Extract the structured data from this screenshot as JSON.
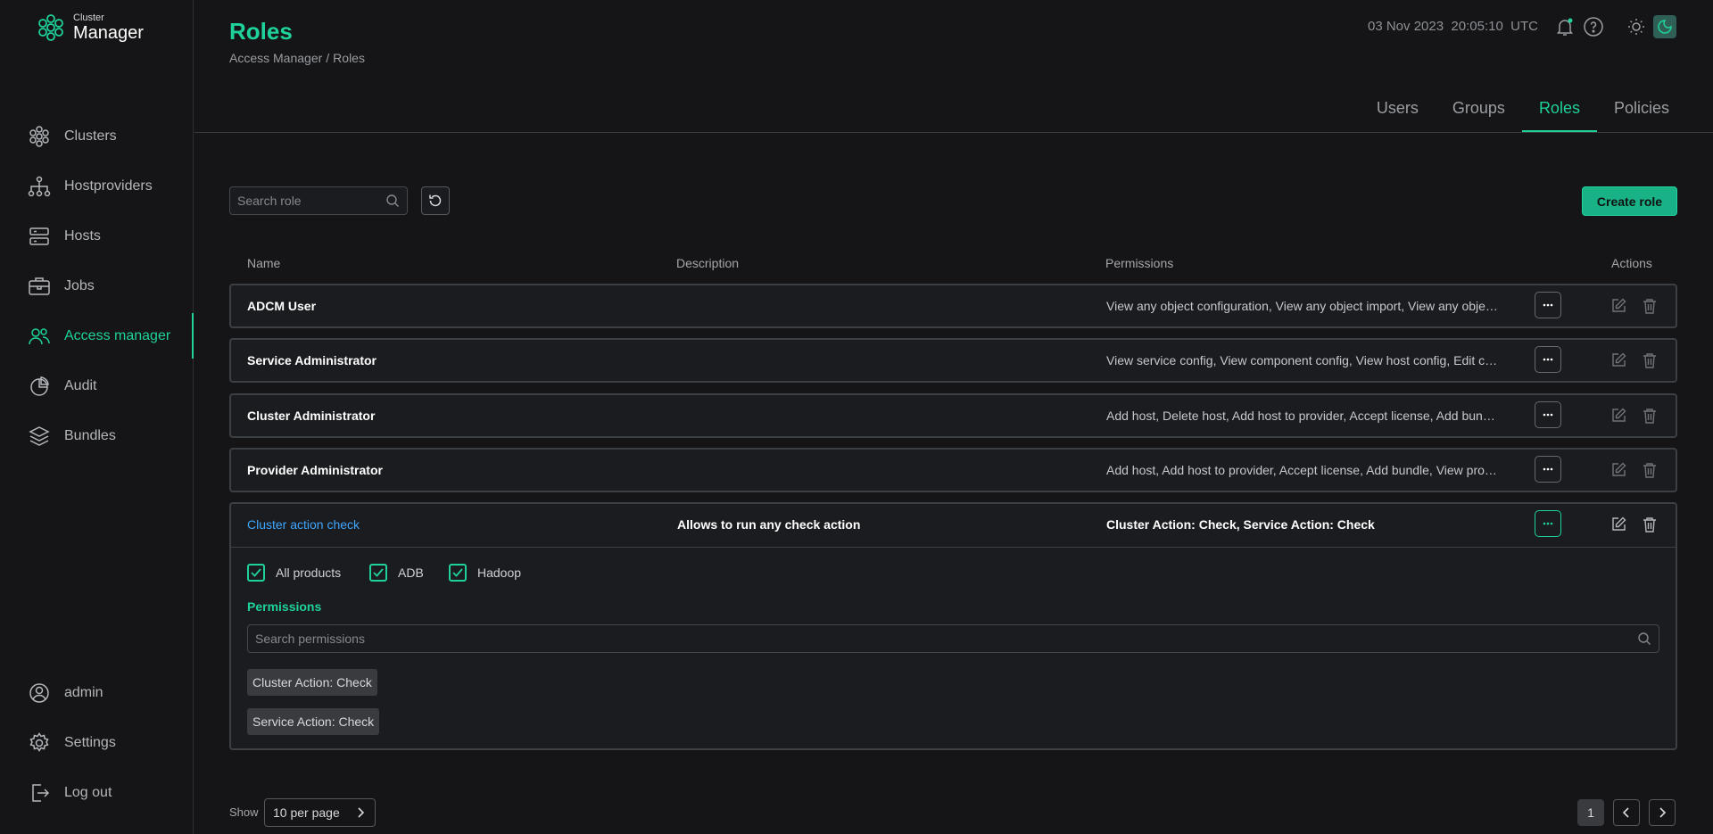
{
  "app": {
    "logo_small": "Cluster",
    "logo_big": "Manager"
  },
  "sidebar": {
    "items": [
      {
        "label": "Clusters",
        "icon": "clusters-icon"
      },
      {
        "label": "Hostproviders",
        "icon": "hostproviders-icon"
      },
      {
        "label": "Hosts",
        "icon": "hosts-icon"
      },
      {
        "label": "Jobs",
        "icon": "jobs-icon"
      },
      {
        "label": "Access manager",
        "icon": "access-manager-icon",
        "active": true
      },
      {
        "label": "Audit",
        "icon": "audit-icon"
      },
      {
        "label": "Bundles",
        "icon": "bundles-icon"
      }
    ],
    "bottom": [
      {
        "label": "admin",
        "icon": "user-icon"
      },
      {
        "label": "Settings",
        "icon": "gear-icon"
      },
      {
        "label": "Log out",
        "icon": "logout-icon"
      }
    ]
  },
  "header": {
    "title": "Roles",
    "breadcrumb": [
      "Access Manager",
      "/",
      "Roles"
    ],
    "date": "03 Nov 2023",
    "time": "20:05:10",
    "timezone": "UTC"
  },
  "tabs": [
    {
      "label": "Users"
    },
    {
      "label": "Groups"
    },
    {
      "label": "Roles",
      "active": true
    },
    {
      "label": "Policies"
    }
  ],
  "toolbar": {
    "search_placeholder": "Search role",
    "create_label": "Create role"
  },
  "table": {
    "columns": {
      "name": "Name",
      "description": "Description",
      "permissions": "Permissions",
      "actions": "Actions"
    },
    "rows": [
      {
        "name": "ADCM User",
        "description": "",
        "permissions": "View any object configuration, View any object import, View any object host-components, View any object host-providers"
      },
      {
        "name": "Service Administrator",
        "description": "",
        "permissions": "View service config, View component config, View host config, Edit component configurations"
      },
      {
        "name": "Cluster Administrator",
        "description": "",
        "permissions": "Add host, Delete host, Add host to provider, Accept license, Add bundle, Remove bundle"
      },
      {
        "name": "Provider Administrator",
        "description": "",
        "permissions": "Add host, Add host to provider, Accept license, Add bundle, View provider configurations"
      },
      {
        "name": "Cluster action check",
        "description": "Allows to run any check action",
        "permissions": "Cluster Action: Check, Service Action: Check",
        "expanded": true
      }
    ],
    "expanded": {
      "products": [
        "All products",
        "ADB",
        "Hadoop"
      ],
      "permissions_label": "Permissions",
      "search_placeholder": "Search permissions",
      "chips": [
        "Cluster Action: Check",
        "Service Action: Check"
      ]
    }
  },
  "pagination": {
    "show_label": "Show",
    "per_page": "10 per page",
    "current_page": "1"
  },
  "colors": {
    "accent": "#1fd19a",
    "link": "#3ea6ff",
    "background": "#151517"
  }
}
